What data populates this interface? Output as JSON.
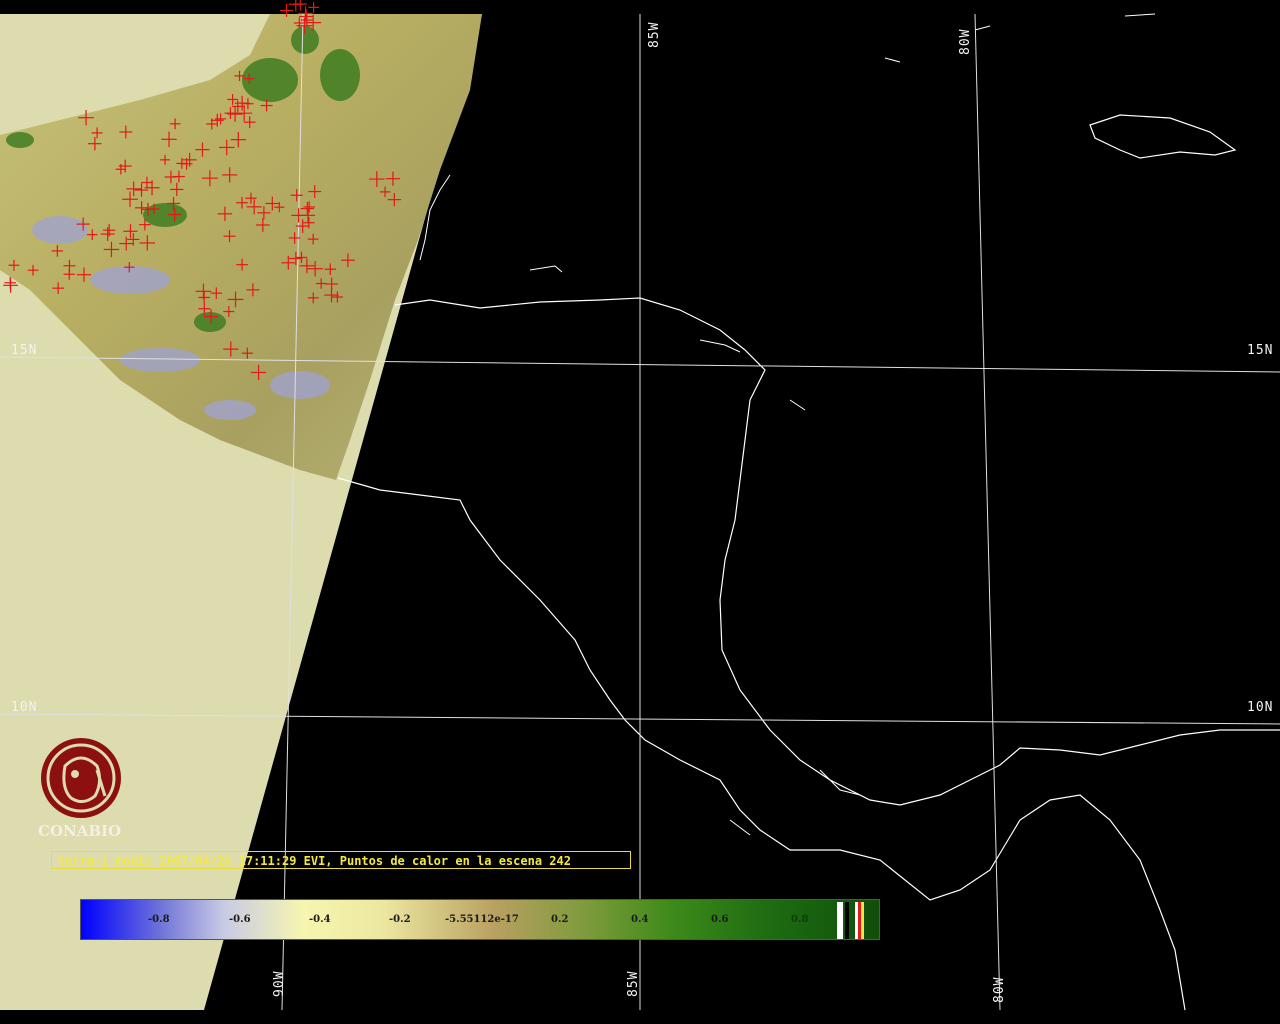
{
  "colors": {
    "land_fill": "#dcdcae",
    "ocean": "#000000",
    "coastline": "#ffffff",
    "grid": "#e8e8e8",
    "hotspot": "#e31818",
    "caption": "#f4e842",
    "logo": "#8c1010"
  },
  "grid_labels": {
    "top_85w": "85W",
    "top_80w": "80W",
    "left_15n": "15N",
    "right_15n": "15N",
    "left_10n": "10N",
    "right_10n": "10N",
    "bottom_90w": "90W",
    "bottom_85w": "85W",
    "bottom_80w": "80W"
  },
  "logo": {
    "icon": "conabio-logo-icon",
    "text": "CONABIO"
  },
  "caption": "terra-1 modis 2007/04/26 17:11:29 EVI, Puntos de calor en la escena 242",
  "colorbar": {
    "ticks": [
      "-0.8",
      "-0.6",
      "-0.4",
      "-0.2",
      "-5.55112e-17",
      "0.2",
      "0.4",
      "0.6",
      "0.8"
    ]
  }
}
